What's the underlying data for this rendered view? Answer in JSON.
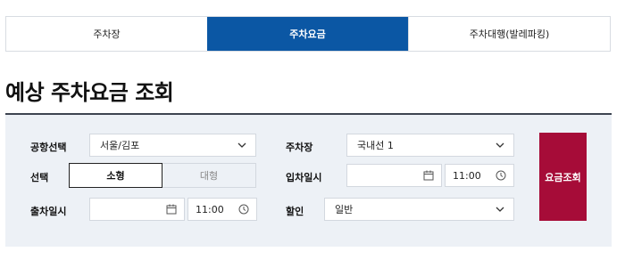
{
  "tabs": [
    {
      "label": "주차장"
    },
    {
      "label": "주차요금"
    },
    {
      "label": "주차대행(발레파킹)"
    }
  ],
  "page_title": "예상 주차요금 조회",
  "form": {
    "airport_label": "공항선택",
    "airport_value": "서울/김포",
    "type_label": "선택",
    "type_options": [
      "소형",
      "대형"
    ],
    "type_selected": "소형",
    "exit_label": "출차일시",
    "exit_date": "",
    "exit_time": "11:00",
    "lot_label": "주차장",
    "lot_value": "국내선 1",
    "entry_label": "입차일시",
    "entry_date": "",
    "entry_time": "11:00",
    "discount_label": "할인",
    "discount_value": "일반",
    "search_label": "요금조회"
  },
  "colors": {
    "tab_active": "#0b57a4",
    "search_button": "#a60c38",
    "panel_bg": "#edf1f6"
  },
  "icons": [
    "chevron-down-icon",
    "calendar-icon",
    "clock-icon"
  ]
}
